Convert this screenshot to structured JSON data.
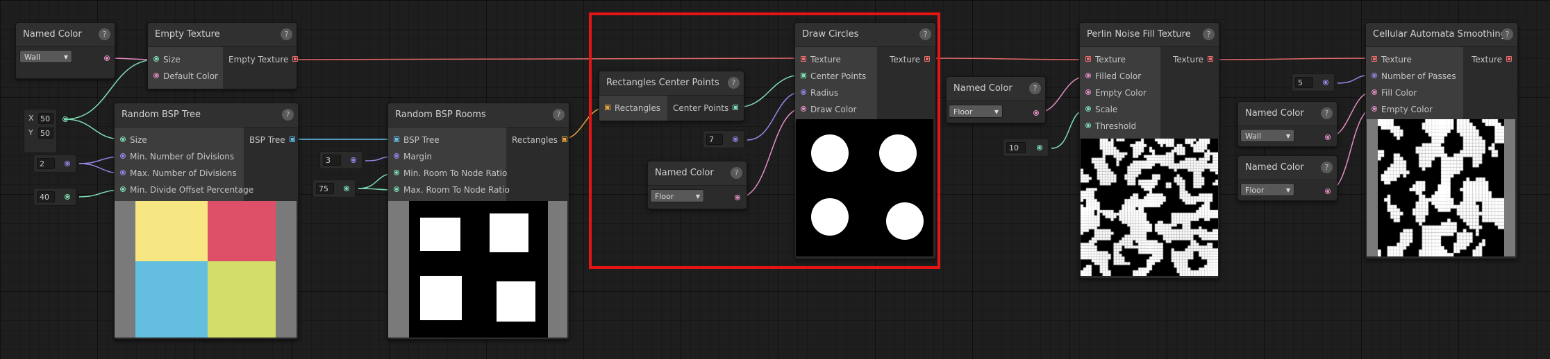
{
  "colors": {
    "highlight": "#e61515",
    "wire_red": "#e46a6a",
    "wire_green": "#7fe0b6",
    "wire_pink": "#e48fc6",
    "wire_purple": "#9a86ea",
    "wire_blue": "#63c3ef",
    "wire_orange": "#f0a93c"
  },
  "help_glyph": "?",
  "nodes": {
    "named_wall": {
      "title": "Named Color",
      "value": "Wall"
    },
    "empty_texture": {
      "title": "Empty Texture",
      "in": [
        "Size",
        "Default Color"
      ],
      "out": [
        "Empty Texture"
      ]
    },
    "random_bsp_tree": {
      "title": "Random BSP Tree",
      "in": [
        "Size",
        "Min. Number of Divisions",
        "Max. Number of Divisions",
        "Min. Divide Offset Percentage"
      ],
      "out": [
        "BSP Tree"
      ]
    },
    "random_bsp_rooms": {
      "title": "Random BSP Rooms",
      "in": [
        "BSP Tree",
        "Margin",
        "Min. Room To Node Ratio",
        "Max. Room To Node Ratio"
      ],
      "out": [
        "Rectangles"
      ]
    },
    "rect_center_points": {
      "title": "Rectangles Center Points",
      "in": [
        "Rectangles"
      ],
      "out": [
        "Center Points"
      ]
    },
    "named_floor_a": {
      "title": "Named Color",
      "value": "Floor"
    },
    "draw_circles": {
      "title": "Draw Circles",
      "in": [
        "Texture",
        "Center Points",
        "Radius",
        "Draw Color"
      ],
      "out": [
        "Texture"
      ]
    },
    "named_floor_b": {
      "title": "Named Color",
      "value": "Floor"
    },
    "perlin": {
      "title": "Perlin Noise Fill Texture",
      "in": [
        "Texture",
        "Filled Color",
        "Empty Color",
        "Scale",
        "Threshold"
      ],
      "out": [
        "Texture"
      ]
    },
    "named_wall_b": {
      "title": "Named Color",
      "value": "Wall"
    },
    "named_floor_c": {
      "title": "Named Color",
      "value": "Floor"
    },
    "cellular": {
      "title": "Cellular Automata Smoothing",
      "in": [
        "Texture",
        "Number of Passes",
        "Fill Color",
        "Empty Color"
      ],
      "out": [
        "Texture"
      ]
    }
  },
  "inputs": {
    "size_x_label": "X",
    "size_x": "50",
    "size_y_label": "Y",
    "size_y": "50",
    "min_divisions": "2",
    "offset_percentage": "40",
    "margin": "3",
    "room_ratio": "75",
    "radius": "7",
    "scale": "10",
    "passes": "5"
  }
}
